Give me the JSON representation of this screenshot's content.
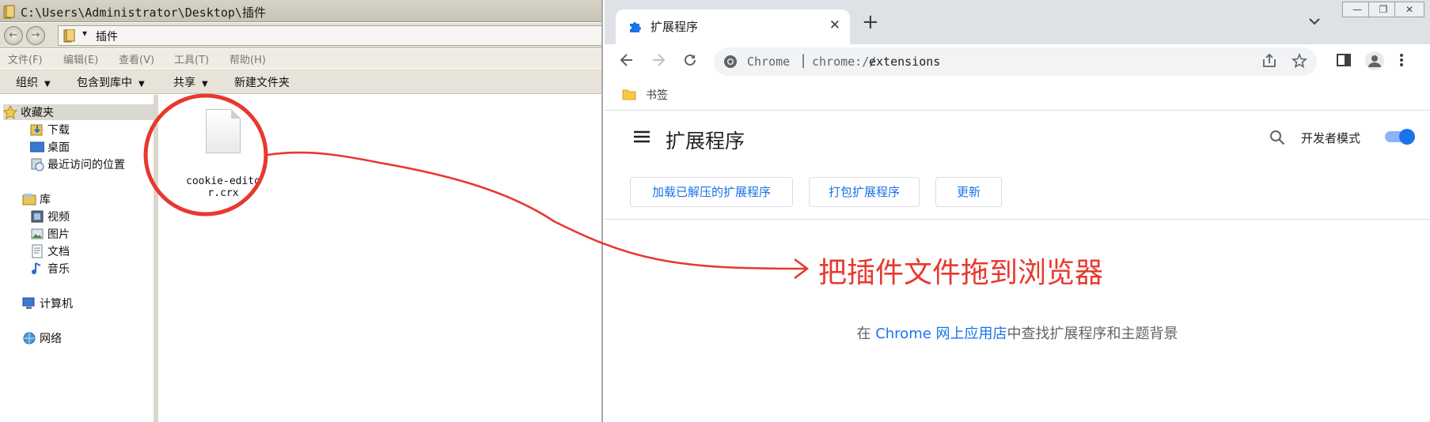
{
  "explorer": {
    "title_path": "C:\\Users\\Administrator\\Desktop\\插件",
    "address": {
      "arrow": "▾",
      "folder": "插件"
    },
    "nav_buttons": {
      "back": "←",
      "forward": "→"
    },
    "menu": [
      "文件(F)",
      "编辑(E)",
      "查看(V)",
      "工具(T)",
      "帮助(H)"
    ],
    "toolbar": [
      {
        "label": "组织",
        "caret": "▼"
      },
      {
        "label": "包含到库中",
        "caret": "▼"
      },
      {
        "label": "共享",
        "caret": "▼"
      },
      {
        "label": "新建文件夹",
        "caret": ""
      }
    ],
    "nav": {
      "favorites": "收藏夹",
      "downloads": "下载",
      "desktop": "桌面",
      "recent": "最近访问的位置",
      "libraries": "库",
      "videos": "视频",
      "pictures": "图片",
      "documents": "文档",
      "music": "音乐",
      "computer": "计算机",
      "network": "网络"
    },
    "file": {
      "name": "cookie-editor.crx"
    }
  },
  "chrome": {
    "tab": {
      "title": "扩展程序",
      "close": "✕"
    },
    "new_tab": "+",
    "tab_search": "⌄",
    "window_controls": {
      "minimize": "—",
      "restore": "❐",
      "close": "✕"
    },
    "omnibox": {
      "site_label": "Chrome",
      "separator": "|",
      "scheme": "chrome://",
      "host": "extensions"
    },
    "bookmarks": {
      "folder_label": "书签"
    },
    "page": {
      "title": "扩展程序",
      "dev_mode_label": "开发者模式",
      "dev_mode_on": true,
      "buttons": [
        "加载已解压的扩展程序",
        "打包扩展程序",
        "更新"
      ],
      "store": {
        "prefix": "在 ",
        "link": "Chrome 网上应用店",
        "suffix": "中查找扩展程序和主题背景"
      }
    },
    "accent_color": "#1a73e8"
  },
  "annotation": {
    "text": "把插件文件拖到浏览器",
    "color": "#e8382f"
  }
}
